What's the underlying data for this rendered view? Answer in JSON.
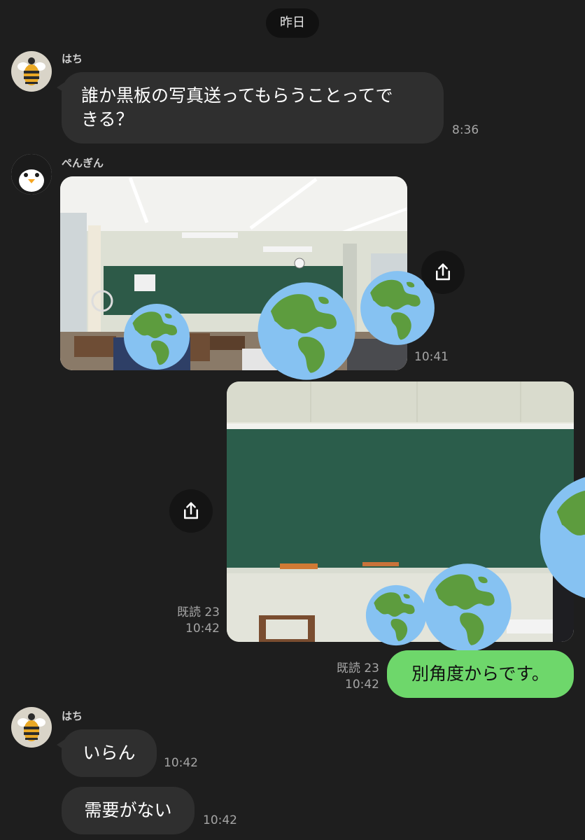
{
  "date_label": "昨日",
  "messages": [
    {
      "sender": "はち",
      "text_line1": "誰か黒板の写真送ってもらうことってで",
      "text_line2": "きる？",
      "time": "8:36"
    },
    {
      "sender": "ぺんぎん",
      "time": "10:41"
    },
    {
      "read": "既読 23",
      "time": "10:42"
    },
    {
      "read": "既読 23",
      "time": "10:42",
      "text": "別角度からです。"
    },
    {
      "sender": "はち",
      "text": "いらん",
      "time": "10:42"
    },
    {
      "text": "需要がない",
      "time": "10:42"
    }
  ],
  "icons": {
    "share": "share-icon",
    "bee_avatar": "bee-avatar",
    "penguin_avatar": "penguin-avatar",
    "globe": "earth-globe-sticker"
  },
  "colors": {
    "background": "#1e1e1e",
    "incoming_bubble": "#2f2f2f",
    "outgoing_bubble": "#6ed76b"
  }
}
